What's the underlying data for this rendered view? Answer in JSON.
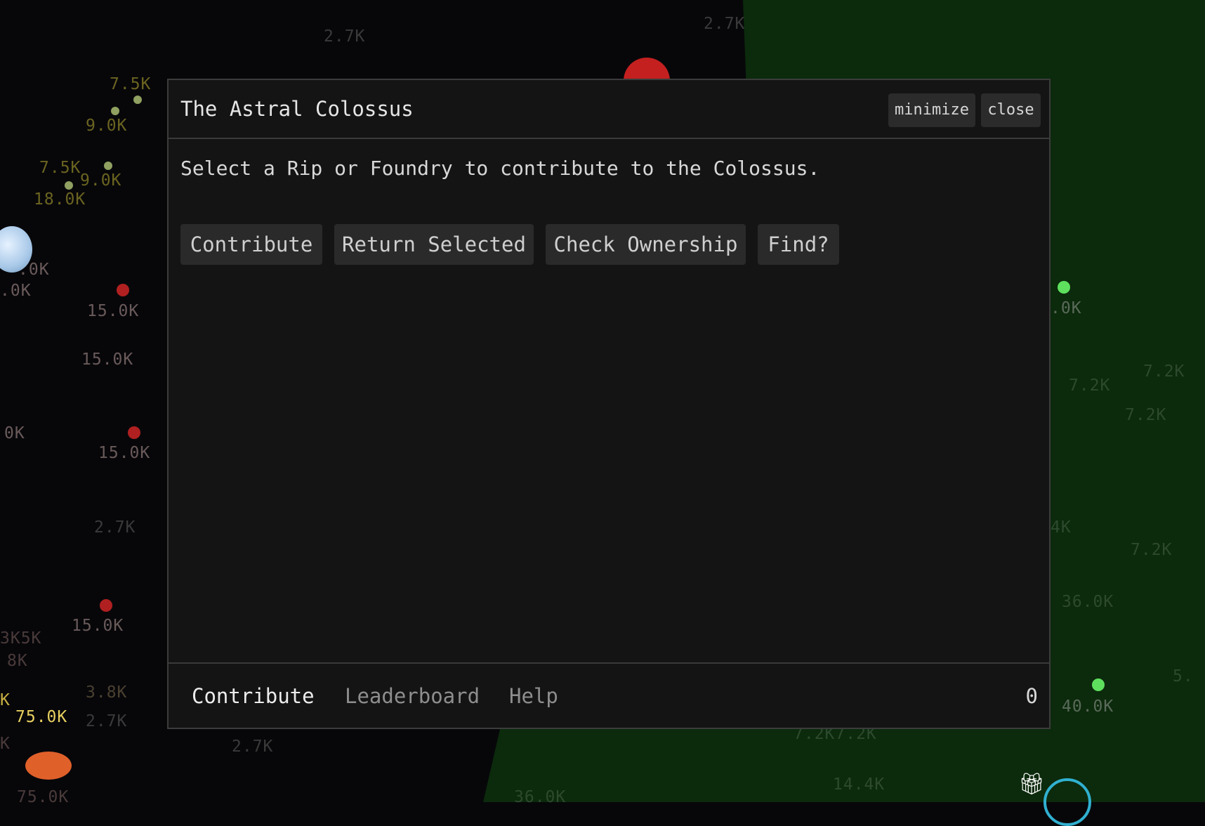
{
  "dialog": {
    "title": "The Astral Colossus",
    "minimize_label": "minimize",
    "close_label": "close",
    "instruction": "Select a Rip or Foundry to contribute to the Colossus.",
    "actions": {
      "contribute": "Contribute",
      "return_selected": "Return Selected",
      "check_ownership": "Check Ownership",
      "find": "Find?"
    },
    "tabs": {
      "contribute": "Contribute",
      "leaderboard": "Leaderboard",
      "help": "Help"
    },
    "count": "0"
  },
  "map": {
    "labels": [
      "2.7K",
      "2.7K",
      "7.5K",
      "9.0K",
      "7.5K",
      "9.0K",
      "18.0K",
      ".0K",
      ".0K",
      "15.0K",
      "15.0K",
      "0K",
      "15.0K",
      "2.7K",
      "15.0K",
      "3K5K",
      "8K",
      "3.8K",
      "75.0K",
      "2.7K",
      "2.7K",
      ".0K",
      "7.2K",
      "7.2K",
      "7.2K",
      "4K",
      "7.2K",
      "36.0K",
      "40.0K",
      "5.",
      "7.2K7.2K",
      "14.4K",
      "36.0K",
      "75.0K",
      "K",
      "K"
    ]
  },
  "colors": {
    "space": "#07070a",
    "green_region": "#0c2a0c",
    "panel": "#141414",
    "panel_border": "#3c3c3c",
    "button": "#2b2b2b"
  }
}
